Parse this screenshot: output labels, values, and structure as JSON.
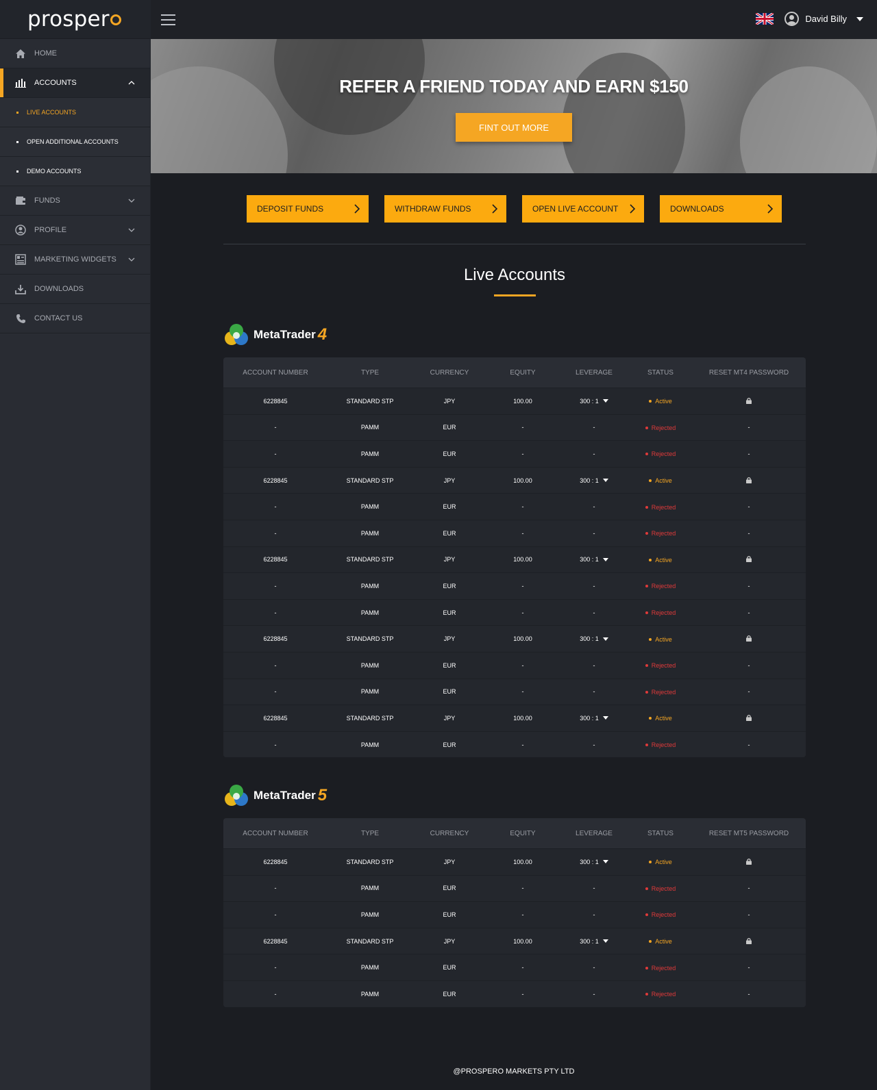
{
  "brand": {
    "name": "prosper"
  },
  "sidebar": {
    "items": [
      {
        "label": "HOME",
        "icon": "home-icon"
      },
      {
        "label": "ACCOUNTS",
        "icon": "chart-icon"
      },
      {
        "label": "FUNDS",
        "icon": "wallet-icon"
      },
      {
        "label": "PROFILE",
        "icon": "user-circle-icon"
      },
      {
        "label": "MARKETING WIDGETS",
        "icon": "widgets-icon"
      },
      {
        "label": "DOWNLOADS",
        "icon": "download-icon"
      },
      {
        "label": "CONTACT US",
        "icon": "phone-icon"
      }
    ],
    "sub_items": [
      "LIVE ACCOUNTS",
      "OPEN ADDITIONAL ACCOUNTS",
      "DEMO ACCOUNTS"
    ]
  },
  "header": {
    "user_name": "David Billy",
    "language_flag": "uk-flag-icon"
  },
  "banner": {
    "title": "REFER A FRIEND TODAY AND EARN $150",
    "button_label": "FINT OUT MORE"
  },
  "actions": [
    "DEPOSIT FUNDS",
    "WITHDRAW FUNDS",
    "OPEN LIVE ACCOUNT",
    "DOWNLOADS"
  ],
  "page_title": "Live Accounts",
  "mt4": {
    "name": "MetaTrader",
    "version": "4",
    "columns": [
      "ACCOUNT NUMBER",
      "TYPE",
      "CURRENCY",
      "EQUITY",
      "LEVERAGE",
      "STATUS",
      "RESET MT4 PASSWORD"
    ],
    "rows": [
      [
        "6228845",
        "STANDARD STP",
        "JPY",
        "100.00",
        "300 : 1",
        "Active",
        "lock"
      ],
      [
        "-",
        "PAMM",
        "EUR",
        "-",
        "-",
        "Rejected",
        "-"
      ],
      [
        "-",
        "PAMM",
        "EUR",
        "-",
        "-",
        "Rejected",
        "-"
      ],
      [
        "6228845",
        "STANDARD STP",
        "JPY",
        "100.00",
        "300 : 1",
        "Active",
        "lock"
      ],
      [
        "-",
        "PAMM",
        "EUR",
        "-",
        "-",
        "Rejected",
        "-"
      ],
      [
        "-",
        "PAMM",
        "EUR",
        "-",
        "-",
        "Rejected",
        "-"
      ],
      [
        "6228845",
        "STANDARD STP",
        "JPY",
        "100.00",
        "300 : 1",
        "Active",
        "lock"
      ],
      [
        "-",
        "PAMM",
        "EUR",
        "-",
        "-",
        "Rejected",
        "-"
      ],
      [
        "-",
        "PAMM",
        "EUR",
        "-",
        "-",
        "Rejected",
        "-"
      ],
      [
        "6228845",
        "STANDARD STP",
        "JPY",
        "100.00",
        "300 : 1",
        "Active",
        "lock"
      ],
      [
        "-",
        "PAMM",
        "EUR",
        "-",
        "-",
        "Rejected",
        "-"
      ],
      [
        "-",
        "PAMM",
        "EUR",
        "-",
        "-",
        "Rejected",
        "-"
      ],
      [
        "6228845",
        "STANDARD STP",
        "JPY",
        "100.00",
        "300 : 1",
        "Active",
        "lock"
      ],
      [
        "-",
        "PAMM",
        "EUR",
        "-",
        "-",
        "Rejected",
        "-"
      ]
    ]
  },
  "mt5": {
    "name": "MetaTrader",
    "version": "5",
    "columns": [
      "ACCOUNT NUMBER",
      "TYPE",
      "CURRENCY",
      "EQUITY",
      "LEVERAGE",
      "STATUS",
      "RESET MT5 PASSWORD"
    ],
    "rows": [
      [
        "6228845",
        "STANDARD STP",
        "JPY",
        "100.00",
        "300 : 1",
        "Active",
        "lock"
      ],
      [
        "-",
        "PAMM",
        "EUR",
        "-",
        "-",
        "Rejected",
        "-"
      ],
      [
        "-",
        "PAMM",
        "EUR",
        "-",
        "-",
        "Rejected",
        "-"
      ],
      [
        "6228845",
        "STANDARD STP",
        "JPY",
        "100.00",
        "300 : 1",
        "Active",
        "lock"
      ],
      [
        "-",
        "PAMM",
        "EUR",
        "-",
        "-",
        "Rejected",
        "-"
      ],
      [
        "-",
        "PAMM",
        "EUR",
        "-",
        "-",
        "Rejected",
        "-"
      ]
    ]
  },
  "footer": {
    "text": "@PROSPERO MARKETS PTY LTD"
  },
  "colors": {
    "accent": "#f5a623",
    "active": "#f5a623",
    "rejected": "#e03a3a",
    "background": "#1b1d22",
    "sidebar": "#292c33"
  }
}
